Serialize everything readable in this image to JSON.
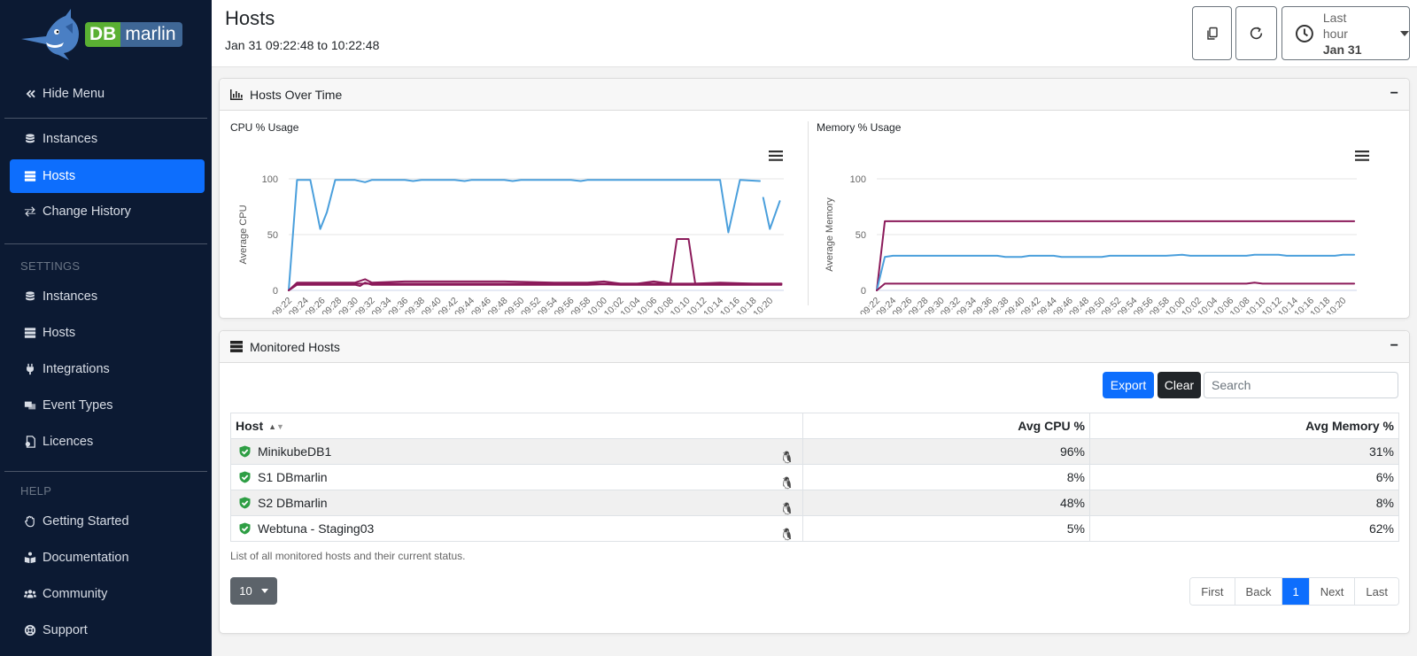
{
  "brand": {
    "db": "DB",
    "marlin": "marlin"
  },
  "sidebar": {
    "hide_menu": "Hide Menu",
    "main_items": [
      {
        "label": "Instances",
        "icon": "database-icon"
      },
      {
        "label": "Hosts",
        "icon": "server-icon",
        "active": true
      },
      {
        "label": "Change History",
        "icon": "arrows-exchange-icon"
      }
    ],
    "settings_label": "SETTINGS",
    "settings_items": [
      {
        "label": "Instances",
        "icon": "database-icon"
      },
      {
        "label": "Hosts",
        "icon": "server-icon"
      },
      {
        "label": "Integrations",
        "icon": "plug-icon"
      },
      {
        "label": "Event Types",
        "icon": "event-types-icon"
      },
      {
        "label": "Licences",
        "icon": "licence-icon"
      }
    ],
    "help_label": "HELP",
    "help_items": [
      {
        "label": "Getting Started",
        "icon": "hand-icon"
      },
      {
        "label": "Documentation",
        "icon": "book-reader-icon"
      },
      {
        "label": "Community",
        "icon": "users-icon"
      },
      {
        "label": "Support",
        "icon": "life-ring-icon"
      }
    ]
  },
  "header": {
    "title": "Hosts",
    "range": "Jan 31 09:22:48 to 10:22:48",
    "time_picker": {
      "label": "Last hour",
      "date": "Jan 31"
    }
  },
  "hosts_over_time": {
    "title": "Hosts Over Time",
    "minimize": "−"
  },
  "chart_data": [
    {
      "type": "line",
      "title": "CPU % Usage",
      "xlabel": "",
      "ylabel": "Average CPU",
      "ylim": [
        0,
        100
      ],
      "yticks": [
        0,
        50,
        100
      ],
      "grid": true,
      "legend": "none",
      "x": [
        "09:22",
        "09:24",
        "09:26",
        "09:28",
        "09:30",
        "09:32",
        "09:34",
        "09:36",
        "09:38",
        "09:40",
        "09:42",
        "09:44",
        "09:46",
        "09:48",
        "09:50",
        "09:52",
        "09:54",
        "09:56",
        "09:58",
        "10:00",
        "10:02",
        "10:04",
        "10:06",
        "10:08",
        "10:10",
        "10:12",
        "10:14",
        "10:16",
        "10:18",
        "10:20"
      ],
      "series": [
        {
          "name": "MinikubeDB1",
          "color": "#4a9fdc",
          "points": [
            [
              0,
              0
            ],
            [
              0.5,
              99
            ],
            [
              1.3,
              99
            ],
            [
              1.9,
              55
            ],
            [
              2.3,
              70
            ],
            [
              2.8,
              99
            ],
            [
              4,
              99
            ],
            [
              4.6,
              97
            ],
            [
              5,
              99
            ],
            [
              7,
              99
            ],
            [
              7.5,
              98
            ],
            [
              8,
              99
            ],
            [
              10,
              99
            ],
            [
              10.6,
              98
            ],
            [
              11,
              99
            ],
            [
              13,
              99
            ],
            [
              13.5,
              98
            ],
            [
              14,
              99
            ],
            [
              17,
              99
            ],
            [
              17.6,
              98
            ],
            [
              18,
              99
            ],
            [
              20,
              99
            ],
            [
              21,
              99
            ],
            [
              22,
              99
            ],
            [
              23,
              99
            ],
            [
              25,
              99
            ],
            [
              25.4,
              99
            ],
            [
              26,
              99
            ],
            [
              26.5,
              52
            ],
            [
              27.2,
              99
            ],
            [
              28.4,
              98
            ],
            [
              28.5,
              null
            ],
            [
              28.6,
              83
            ],
            [
              29,
              55
            ],
            [
              29.6,
              80
            ]
          ]
        },
        {
          "name": "S2 DBmarlin",
          "color": "#8b1a5a",
          "points": [
            [
              0,
              0
            ],
            [
              0.5,
              7
            ],
            [
              2,
              7
            ],
            [
              3,
              7
            ],
            [
              4,
              7
            ],
            [
              4.6,
              10
            ],
            [
              5,
              7
            ],
            [
              7,
              8
            ],
            [
              10,
              8
            ],
            [
              13,
              8
            ],
            [
              16,
              7
            ],
            [
              18,
              7
            ],
            [
              19,
              8
            ],
            [
              20,
              6
            ],
            [
              21,
              6
            ],
            [
              22,
              8
            ],
            [
              23,
              6
            ],
            [
              23.4,
              46
            ],
            [
              24.1,
              46
            ],
            [
              24.5,
              6
            ],
            [
              26,
              7
            ],
            [
              28,
              6
            ],
            [
              29.7,
              6
            ]
          ]
        },
        {
          "name": "S1 DBmarlin",
          "color": "#8b1a5a",
          "points": [
            [
              0,
              0
            ],
            [
              0.5,
              5
            ],
            [
              4,
              5
            ],
            [
              4.3,
              4
            ],
            [
              4.6,
              7
            ],
            [
              5,
              5
            ],
            [
              10,
              5
            ],
            [
              18,
              5
            ],
            [
              19,
              5.5
            ],
            [
              20,
              5
            ],
            [
              21,
              5
            ],
            [
              23.2,
              5
            ],
            [
              29.7,
              5
            ]
          ]
        },
        {
          "name": "Webtuna - Staging03",
          "color": "#8b1a5a",
          "points": [
            [
              0,
              0
            ],
            [
              0.5,
              6
            ],
            [
              10,
              6
            ],
            [
              15,
              6
            ],
            [
              23,
              6
            ],
            [
              29.7,
              6
            ]
          ]
        }
      ]
    },
    {
      "type": "line",
      "title": "Memory % Usage",
      "xlabel": "",
      "ylabel": "Average Memory",
      "ylim": [
        0,
        100
      ],
      "yticks": [
        0,
        50,
        100
      ],
      "grid": true,
      "legend": "none",
      "x": [
        "09:22",
        "09:24",
        "09:26",
        "09:28",
        "09:30",
        "09:32",
        "09:34",
        "09:36",
        "09:38",
        "09:40",
        "09:42",
        "09:44",
        "09:46",
        "09:48",
        "09:50",
        "09:52",
        "09:54",
        "09:56",
        "09:58",
        "10:00",
        "10:02",
        "10:04",
        "10:06",
        "10:08",
        "10:10",
        "10:12",
        "10:14",
        "10:16",
        "10:18",
        "10:20"
      ],
      "series": [
        {
          "name": "Webtuna - Staging03",
          "color": "#8b1a5a",
          "points": [
            [
              0,
              0
            ],
            [
              0.5,
              62
            ],
            [
              29.7,
              62
            ]
          ]
        },
        {
          "name": "MinikubeDB1",
          "color": "#4a9fdc",
          "points": [
            [
              0,
              0
            ],
            [
              0.5,
              30
            ],
            [
              1,
              31
            ],
            [
              7.5,
              31
            ],
            [
              8,
              30
            ],
            [
              9,
              30
            ],
            [
              9.5,
              31
            ],
            [
              11,
              31
            ],
            [
              11.5,
              30
            ],
            [
              14,
              30
            ],
            [
              14.5,
              31
            ],
            [
              18,
              31
            ],
            [
              19,
              32
            ],
            [
              19.5,
              31
            ],
            [
              23,
              31
            ],
            [
              23.5,
              32
            ],
            [
              25,
              32
            ],
            [
              25.5,
              31
            ],
            [
              28.5,
              31
            ],
            [
              29,
              32
            ],
            [
              29.7,
              32
            ]
          ]
        },
        {
          "name": "S2 DBmarlin",
          "color": "#8b1a5a",
          "points": [
            [
              0,
              0
            ],
            [
              0.5,
              6
            ],
            [
              23,
              6
            ],
            [
              23.5,
              7
            ],
            [
              24,
              6
            ],
            [
              29.7,
              6
            ]
          ]
        }
      ]
    }
  ],
  "monitored_hosts": {
    "title": "Monitored Hosts",
    "minimize": "−",
    "export_label": "Export",
    "clear_label": "Clear",
    "search_placeholder": "Search",
    "search_value": "",
    "columns": [
      "Host",
      "Avg CPU %",
      "Avg Memory %"
    ],
    "rows": [
      {
        "host": "MinikubeDB1",
        "status": "ok",
        "os": "linux",
        "cpu": "96%",
        "memory": "31%"
      },
      {
        "host": "S1 DBmarlin",
        "status": "ok",
        "os": "linux",
        "cpu": "8%",
        "memory": "6%"
      },
      {
        "host": "S2 DBmarlin",
        "status": "ok",
        "os": "linux",
        "cpu": "48%",
        "memory": "8%"
      },
      {
        "host": "Webtuna - Staging03",
        "status": "ok",
        "os": "linux",
        "cpu": "5%",
        "memory": "62%"
      }
    ],
    "caption": "List of all monitored hosts and their current status.",
    "page_size": "10",
    "pager": {
      "first": "First",
      "back": "Back",
      "current": "1",
      "next": "Next",
      "last": "Last"
    }
  },
  "colors": {
    "accent": "#0d6efd",
    "sidebar_bg": "#0c1a33",
    "cpu_blue": "#4a9fdc",
    "series_purple": "#8b1a5a",
    "status_ok": "#2e9e44"
  }
}
